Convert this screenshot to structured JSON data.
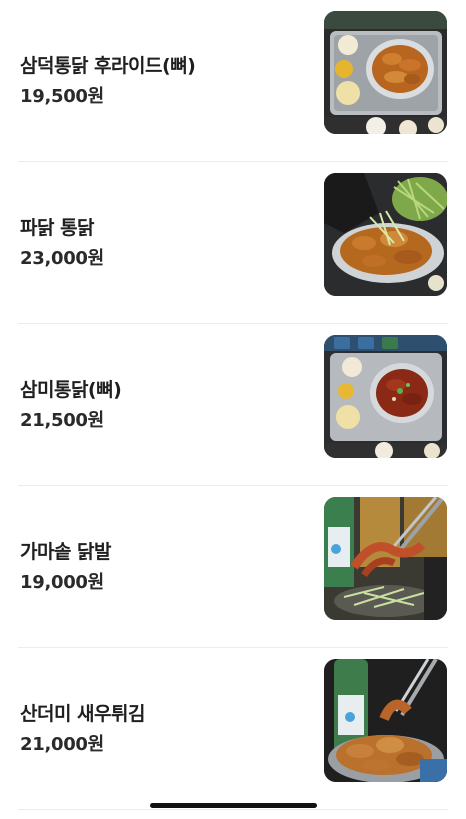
{
  "menu": {
    "items": [
      {
        "name": "삼덕통닭 후라이드(뼈)",
        "price": "19,500원",
        "image": "fried-chicken-tray-photo"
      },
      {
        "name": "파닭 통닭",
        "price": "23,000원",
        "image": "green-onion-chicken-photo"
      },
      {
        "name": "삼미통닭(뼈)",
        "price": "21,500원",
        "image": "sweet-spicy-chicken-tray-photo"
      },
      {
        "name": "가마솥 닭발",
        "price": "19,000원",
        "image": "chicken-feet-tongs-photo"
      },
      {
        "name": "산더미 새우튀김",
        "price": "21,000원",
        "image": "fried-shrimp-pile-photo"
      }
    ]
  },
  "colors": {
    "text": "#1f1f1f",
    "divider": "#ececec",
    "home_indicator": "#111111"
  }
}
